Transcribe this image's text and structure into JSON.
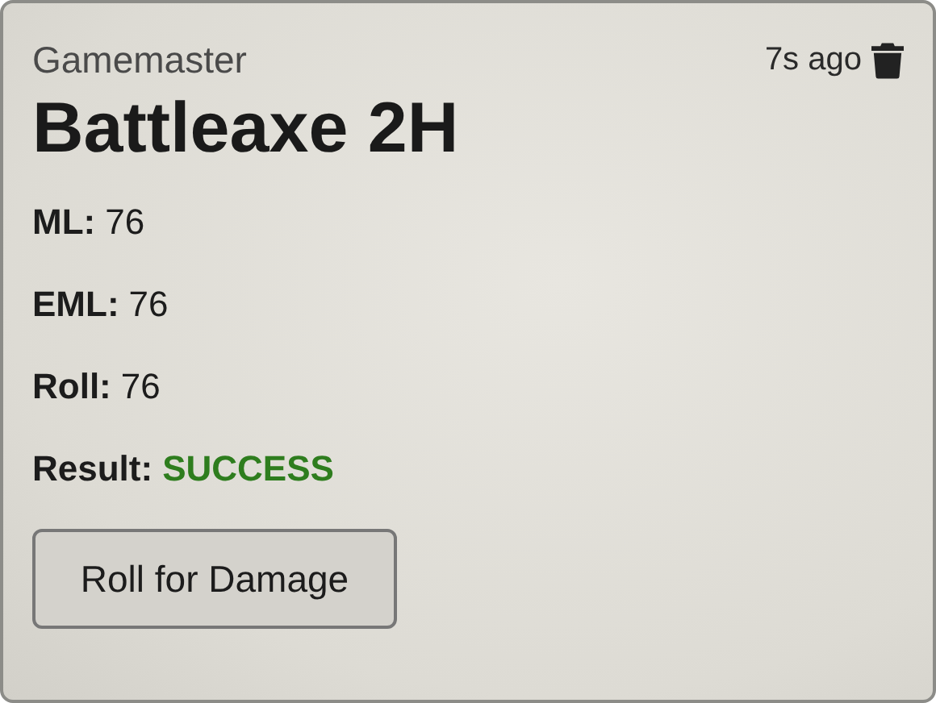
{
  "header": {
    "author": "Gamemaster",
    "time": "7s ago"
  },
  "title": "Battleaxe 2H",
  "fields": [
    {
      "label": "ML:",
      "value": "76",
      "kind": "plain"
    },
    {
      "label": "EML:",
      "value": "76",
      "kind": "plain"
    },
    {
      "label": "Roll:",
      "value": "76",
      "kind": "plain"
    },
    {
      "label": "Result:",
      "value": "SUCCESS",
      "kind": "success"
    }
  ],
  "button": "Roll for Damage"
}
